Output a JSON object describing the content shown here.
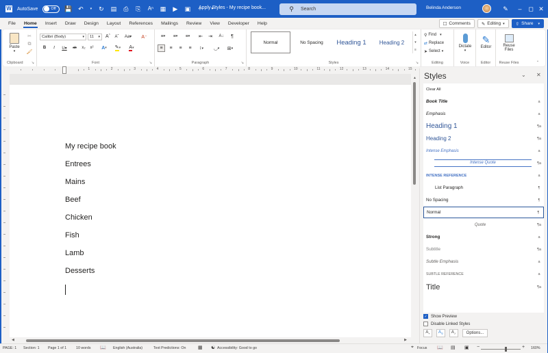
{
  "titlebar": {
    "autosave_label": "AutoSave",
    "autosave_state": "Off",
    "doc_title": "Apply Styles - My recipe book...",
    "search_placeholder": "Search",
    "user_name": "Belinda Anderson",
    "accent_color": "#1d5fc5"
  },
  "menu": {
    "tabs": [
      "File",
      "Home",
      "Insert",
      "Draw",
      "Design",
      "Layout",
      "References",
      "Mailings",
      "Review",
      "View",
      "Developer",
      "Help"
    ],
    "active_tab": "Home",
    "comments_label": "Comments",
    "editing_label": "Editing",
    "share_label": "Share"
  },
  "ribbon": {
    "clipboard": {
      "paste_label": "Paste",
      "group_label": "Clipboard"
    },
    "font": {
      "font_name": "Calibri (Body)",
      "font_size": "11",
      "group_label": "Font",
      "case_label": "Aa"
    },
    "paragraph": {
      "group_label": "Paragraph"
    },
    "styles": {
      "items": [
        "Normal",
        "No Spacing",
        "Heading 1",
        "Heading 2"
      ],
      "selected": "Normal",
      "group_label": "Styles"
    },
    "editing": {
      "find_label": "Find",
      "replace_label": "Replace",
      "select_label": "Select",
      "group_label": "Editing"
    },
    "voice": {
      "dictate_label": "Dictate",
      "group_label": "Voice"
    },
    "editor": {
      "editor_label": "Editor",
      "group_label": "Editor"
    },
    "reuse": {
      "label_line1": "Reuse",
      "label_line2": "Files",
      "group_label": "Reuse Files"
    }
  },
  "ruler": {
    "numbers": [
      "1",
      "2",
      "3",
      "4",
      "5",
      "6",
      "7",
      "8",
      "9",
      "10",
      "11",
      "12",
      "13",
      "14",
      "15"
    ]
  },
  "document": {
    "lines": [
      "My recipe book",
      "Entrees",
      "Mains",
      "Beef",
      "Chicken",
      "Fish",
      "Lamb",
      "Desserts"
    ]
  },
  "styles_pane": {
    "title": "Styles",
    "items": [
      {
        "name": "Clear All",
        "mark": ""
      },
      {
        "name": "Book Title",
        "mark": "a"
      },
      {
        "name": "Emphasis",
        "mark": "a"
      },
      {
        "name": "Heading 1",
        "mark": "¶a"
      },
      {
        "name": "Heading 2",
        "mark": "¶a"
      },
      {
        "name": "Intense Emphasis",
        "mark": "a"
      },
      {
        "name": "Intense Quote",
        "mark": "¶a"
      },
      {
        "name": "Intense Reference",
        "mark": "a"
      },
      {
        "name": "List Paragraph",
        "mark": "¶"
      },
      {
        "name": "No Spacing",
        "mark": "¶"
      },
      {
        "name": "Normal",
        "mark": "¶"
      },
      {
        "name": "Quote",
        "mark": "¶a"
      },
      {
        "name": "Strong",
        "mark": "a"
      },
      {
        "name": "Subtitle",
        "mark": "¶a"
      },
      {
        "name": "Subtle Emphasis",
        "mark": "a"
      },
      {
        "name": "Subtle Reference",
        "mark": "a"
      },
      {
        "name": "Title",
        "mark": "¶a"
      }
    ],
    "selected": "Normal",
    "show_preview_label": "Show Preview",
    "show_preview_checked": true,
    "disable_linked_label": "Disable Linked Styles",
    "disable_linked_checked": false,
    "options_label": "Options..."
  },
  "statusbar": {
    "page": "PAGE: 1",
    "section": "Section: 1",
    "page_of": "Page 1 of 1",
    "words": "10 words",
    "language": "English (Australia)",
    "text_predictions": "Text Predictions: On",
    "accessibility": "Accessibility: Good to go",
    "focus": "Focus",
    "zoom": "160%",
    "zoom_level_percent": 160
  }
}
